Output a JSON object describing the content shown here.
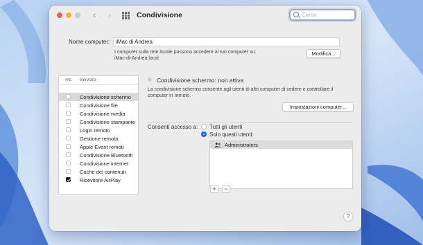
{
  "window": {
    "title": "Condivisione"
  },
  "search": {
    "placeholder": "Cerca"
  },
  "computer_name": {
    "label": "Nome computer:",
    "value": "iMac di Andrea",
    "description_line1": "I computer sulla rete locale possono accedere al tuo computer su:",
    "description_line2": "iMac-di-Andrea.local",
    "edit_button": "Modifica..."
  },
  "services": {
    "header_on": "Att.",
    "header_service": "Servizio",
    "items": [
      {
        "label": "Condivisione schermo",
        "checked": false,
        "selected": true
      },
      {
        "label": "Condivisione file",
        "checked": false,
        "selected": false
      },
      {
        "label": "Condivisione media",
        "checked": false,
        "selected": false
      },
      {
        "label": "Condivisione stampante",
        "checked": false,
        "selected": false
      },
      {
        "label": "Login remoto",
        "checked": false,
        "selected": false
      },
      {
        "label": "Gestione remota",
        "checked": false,
        "selected": false
      },
      {
        "label": "Apple Event remoti",
        "checked": false,
        "selected": false
      },
      {
        "label": "Condivisione Bluetooth",
        "checked": false,
        "selected": false
      },
      {
        "label": "Condivisione internet",
        "checked": false,
        "selected": false
      },
      {
        "label": "Cache dei contenuti",
        "checked": false,
        "selected": false
      },
      {
        "label": "Ricevitore AirPlay",
        "checked": true,
        "selected": false
      }
    ]
  },
  "detail": {
    "status": "Condivisione schermo: non attiva",
    "description_line1": "La condivisione schermo consente agli utenti di altri computer di vedere e controllare il",
    "description_line2": "computer in remoto.",
    "settings_button": "Impostazioni computer...",
    "access_label": "Consenti accesso a:",
    "option_all": "Tutti gli utenti",
    "option_only": "Solo questi utenti:",
    "selected_option": "only",
    "users": [
      "Administrators"
    ],
    "add_button": "+",
    "remove_button": "−"
  },
  "help_button": "?",
  "colors": {
    "accent": "#1a66d8",
    "close": "#ec5f57",
    "minimize": "#e9b532",
    "zoom_disabled": "#c9c9c9",
    "window_bg": "#ececec"
  }
}
